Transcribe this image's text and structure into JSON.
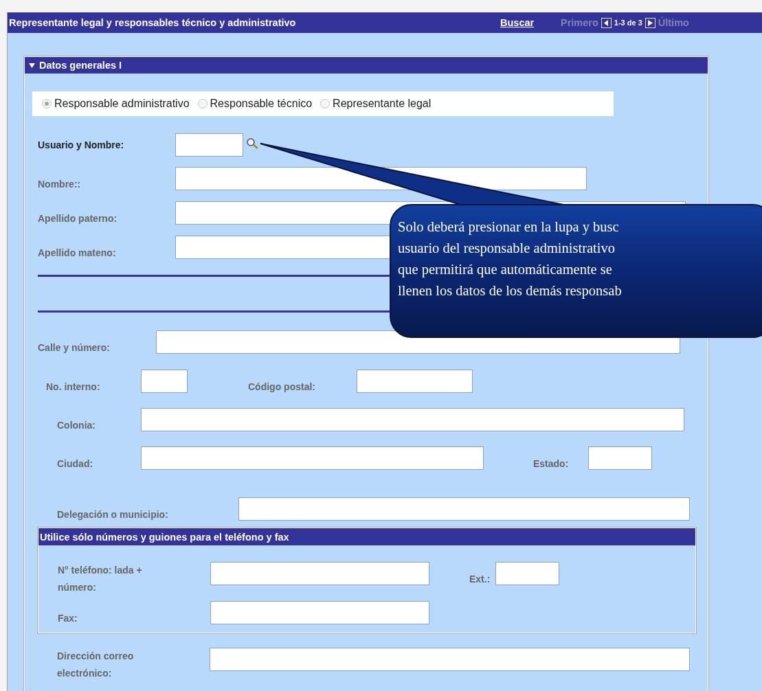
{
  "header": {
    "title": "Representante legal y responsables técnico y administrativo",
    "search_link": "Buscar",
    "nav": {
      "first": {
        "label": "Primero",
        "disabled": true
      },
      "range": "1-3 de 3",
      "last": {
        "label": "Último",
        "disabled": true
      }
    }
  },
  "section": {
    "title": "Datos generales I",
    "expanded": true,
    "role_options": [
      {
        "label": "Responsable administrativo",
        "selected": true
      },
      {
        "label": "Responsable técnico",
        "selected": false
      },
      {
        "label": "Representante legal",
        "selected": false
      }
    ],
    "user_field": {
      "label": "Usuario y Nombre:",
      "disabled": false
    },
    "name_fields": [
      {
        "label": "Nombre::",
        "disabled": true
      },
      {
        "label": "Apellido paterno:",
        "disabled": true
      },
      {
        "label": "Apellido mateno:",
        "disabled": true
      }
    ],
    "address_fields": [
      {
        "label": "Calle y número:",
        "disabled": true
      },
      {
        "label": "No. interno:",
        "disabled": true
      },
      {
        "label": "Código postal:",
        "disabled": true
      },
      {
        "label": "Colonia:",
        "disabled": true
      },
      {
        "label": "Ciudad:",
        "disabled": true
      },
      {
        "label": "Estado:",
        "disabled": true
      },
      {
        "label": "Delegación o municipio:",
        "disabled": true
      }
    ],
    "phone_panel": {
      "title": "Utilice sólo números y guiones para el teléfono y fax",
      "fields": [
        {
          "label": "N° teléfono: lada + número:",
          "disabled": true
        },
        {
          "label": "Ext.:",
          "disabled": true
        },
        {
          "label": "Fax:",
          "disabled": true
        }
      ]
    },
    "email_field": {
      "label": "Dirección correo electrónico:",
      "disabled": true
    }
  },
  "callout": {
    "lines": [
      "Solo deberá presionar en la lupa y busc",
      "usuario del responsable administrativo",
      "que permitirá que automáticamente se",
      "llenen los datos de los demás responsab"
    ]
  }
}
